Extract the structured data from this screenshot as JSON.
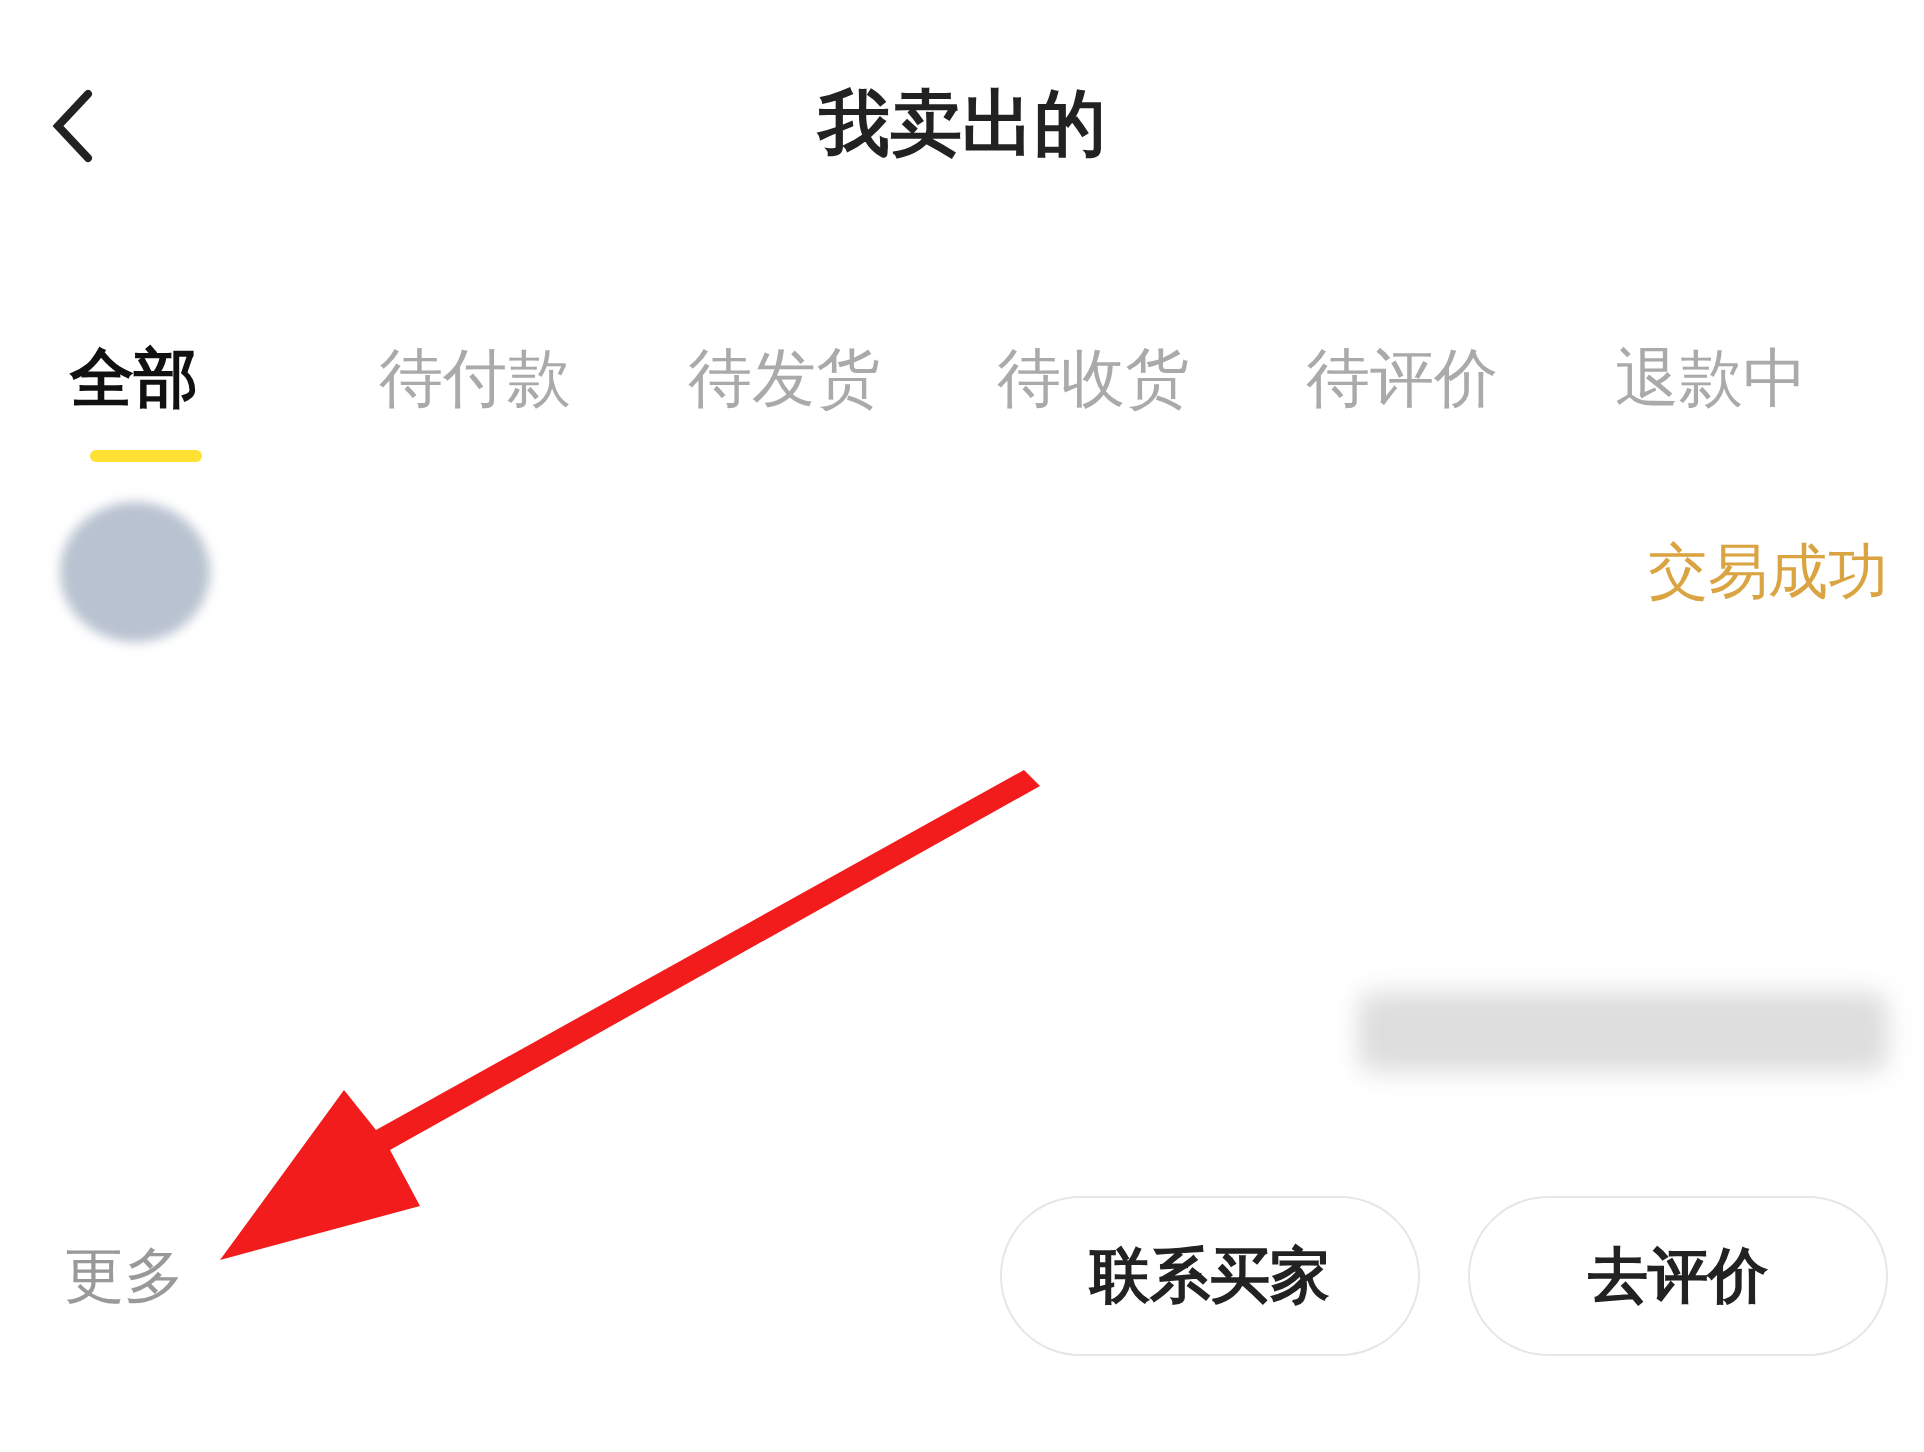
{
  "header": {
    "title": "我卖出的"
  },
  "tabs": [
    {
      "label": "全部",
      "selected": true
    },
    {
      "label": "待付款",
      "selected": false
    },
    {
      "label": "待发货",
      "selected": false
    },
    {
      "label": "待收货",
      "selected": false
    },
    {
      "label": "待评价",
      "selected": false
    },
    {
      "label": "退款中",
      "selected": false
    }
  ],
  "order": {
    "status": "交易成功",
    "more": "更多",
    "buttons": [
      "联系买家",
      "去评价"
    ]
  }
}
